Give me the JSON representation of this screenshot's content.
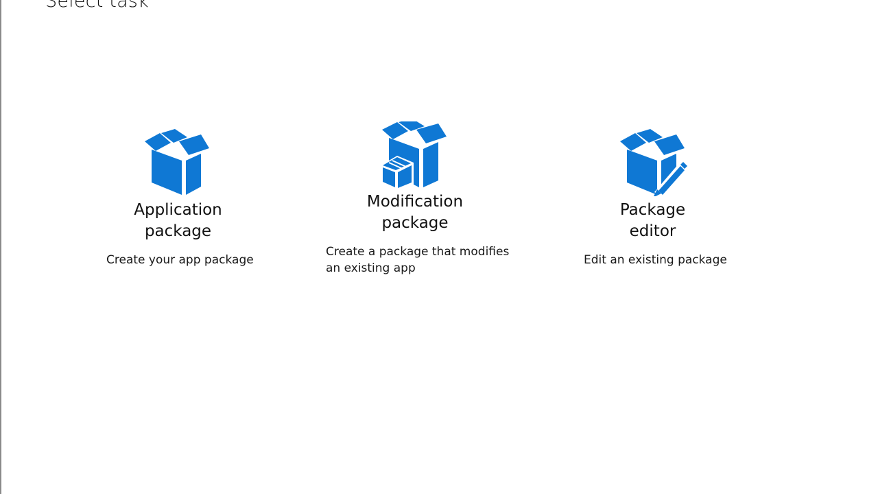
{
  "page": {
    "title": "Select task"
  },
  "tasks": [
    {
      "name_line1": "Application",
      "name_line2": "package",
      "description": "Create your app package",
      "icon": "package-box-icon"
    },
    {
      "name_line1": "Modification",
      "name_line2": "package",
      "description_line1": "Create a package that modifies",
      "description_line2": "an existing app",
      "icon": "package-modification-icon"
    },
    {
      "name_line1": "Package",
      "name_line2": "editor",
      "description": "Edit an existing package",
      "icon": "package-edit-icon"
    }
  ],
  "colors": {
    "accent": "#0f78d4",
    "accent_dark": "#0a5fb0",
    "text": "#111111",
    "background": "#ffffff"
  }
}
